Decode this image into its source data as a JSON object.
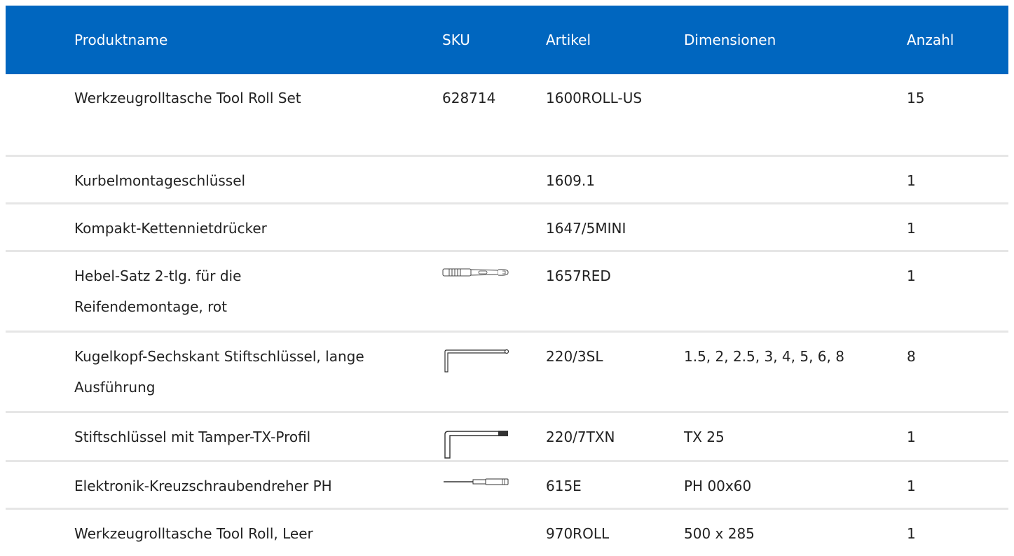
{
  "table": {
    "headers": {
      "name": "Produktname",
      "sku": "SKU",
      "article": "Artikel",
      "dimensions": "Dimensionen",
      "quantity": "Anzahl"
    },
    "rows": [
      {
        "name": "Werkzeugrolltasche Tool Roll Set",
        "sku": "628714",
        "article": "1600ROLL-US",
        "dimensions": "",
        "quantity": "15",
        "image_icon": ""
      },
      {
        "name": "Kurbelmontageschlüssel",
        "sku": "",
        "article": "1609.1",
        "dimensions": "",
        "quantity": "1",
        "image_icon": ""
      },
      {
        "name": "Kompakt-Kettennietdrücker",
        "sku": "",
        "article": "1647/5MINI",
        "dimensions": "",
        "quantity": "1",
        "image_icon": ""
      },
      {
        "name": "Hebel-Satz 2-tlg. für die Reifendemontage, rot",
        "sku": "",
        "article": "1657RED",
        "dimensions": "",
        "quantity": "1",
        "image_icon": "tire-lever-icon"
      },
      {
        "name": "Kugelkopf-Sechskant Stiftschlüssel, lange Ausführung",
        "sku": "",
        "article": "220/3SL",
        "dimensions": "1.5, 2, 2.5, 3, 4, 5, 6, 8",
        "quantity": "8",
        "image_icon": "hex-key-icon"
      },
      {
        "name": "Stiftschlüssel mit Tamper-TX-Profil",
        "sku": "",
        "article": "220/7TXN",
        "dimensions": "TX 25",
        "quantity": "1",
        "image_icon": "torx-key-icon"
      },
      {
        "name": "Elektronik-Kreuzschraubendreher PH",
        "sku": "",
        "article": "615E",
        "dimensions": "PH 00x60",
        "quantity": "1",
        "image_icon": "screwdriver-icon"
      },
      {
        "name": "Werkzeugrolltasche Tool Roll, Leer",
        "sku": "",
        "article": "970ROLL",
        "dimensions": "500 x 285",
        "quantity": "1",
        "image_icon": ""
      }
    ]
  },
  "colors": {
    "header_bg": "#0066bf",
    "header_text": "#ffffff",
    "row_divider": "#e6e6e6"
  }
}
